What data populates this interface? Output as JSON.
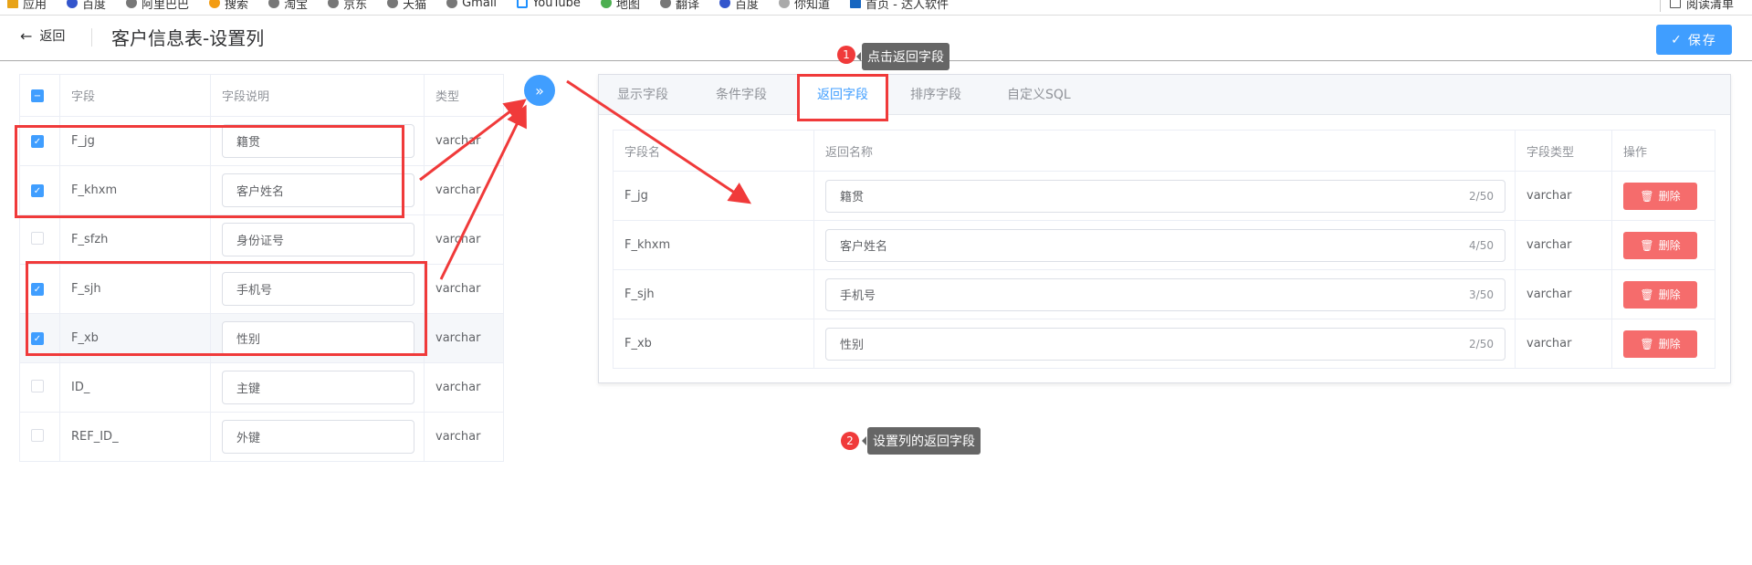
{
  "bookmarks": [
    "应用",
    "百度",
    "阿里巴巴",
    "搜索",
    "淘宝",
    "京东",
    "天猫",
    "Gmail",
    "YouTube",
    "地图",
    "翻译",
    "百度",
    "你知道",
    "首页 - 达人软件"
  ],
  "reading_list": "阅读清单",
  "header": {
    "back": "返回",
    "title": "客户信息表-设置列",
    "save": "保存"
  },
  "left_table": {
    "headers": [
      "字段",
      "字段说明",
      "类型"
    ],
    "rows": [
      {
        "checked": true,
        "field": "F_jg",
        "desc": "籍贯",
        "type": "varchar"
      },
      {
        "checked": true,
        "field": "F_khxm",
        "desc": "客户姓名",
        "type": "varchar"
      },
      {
        "checked": false,
        "field": "F_sfzh",
        "desc": "身份证号",
        "type": "varchar"
      },
      {
        "checked": true,
        "field": "F_sjh",
        "desc": "手机号",
        "type": "varchar"
      },
      {
        "checked": true,
        "field": "F_xb",
        "desc": "性别",
        "type": "varchar"
      },
      {
        "checked": false,
        "field": "ID_",
        "desc": "主键",
        "type": "varchar"
      },
      {
        "checked": false,
        "field": "REF_ID_",
        "desc": "外键",
        "type": "varchar"
      }
    ]
  },
  "transfer_icon": "double-chevron-right",
  "tabs": [
    {
      "label": "显示字段"
    },
    {
      "label": "条件字段"
    },
    {
      "label": "返回字段",
      "active": true
    },
    {
      "label": "排序字段"
    },
    {
      "label": "自定义SQL"
    }
  ],
  "right_table": {
    "headers": [
      "字段名",
      "返回名称",
      "字段类型",
      "操作"
    ],
    "delete_label": "删除",
    "rows": [
      {
        "field": "F_jg",
        "name": "籍贯",
        "count": "2/50",
        "type": "varchar"
      },
      {
        "field": "F_khxm",
        "name": "客户姓名",
        "count": "4/50",
        "type": "varchar"
      },
      {
        "field": "F_sjh",
        "name": "手机号",
        "count": "3/50",
        "type": "varchar"
      },
      {
        "field": "F_xb",
        "name": "性别",
        "count": "2/50",
        "type": "varchar"
      }
    ]
  },
  "annotations": [
    {
      "num": "1",
      "text": "点击返回字段"
    },
    {
      "num": "2",
      "text": "设置列的返回字段"
    }
  ],
  "colors": {
    "primary": "#409eff",
    "danger": "#f56c6c",
    "annotation": "#f03a3a"
  }
}
